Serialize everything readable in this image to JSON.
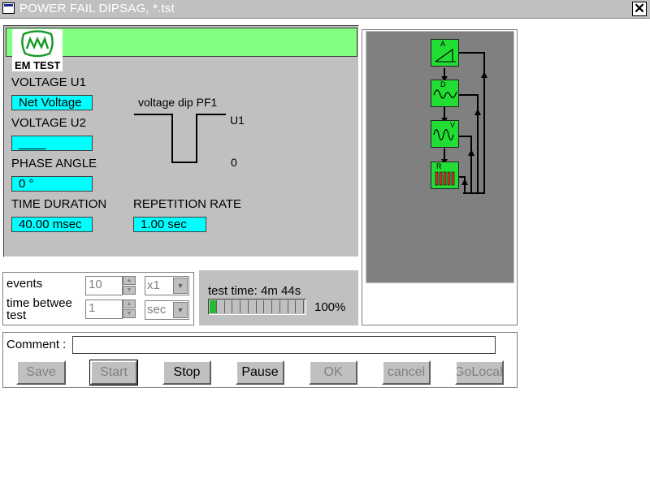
{
  "window": {
    "title": "POWER FAIL DIPSAG, *.tst",
    "close_glyph": "✕"
  },
  "logo": {
    "text": "EM TEST",
    "mark": "em-test-logo"
  },
  "params": {
    "voltage_u1": {
      "label": "VOLTAGE U1",
      "value": "Net Voltage"
    },
    "voltage_u2": {
      "label": "VOLTAGE U2",
      "value": "____"
    },
    "phase_angle": {
      "label": "PHASE ANGLE",
      "value": "0 °"
    },
    "time_duration": {
      "label": "TIME DURATION",
      "value": "40.00 msec"
    },
    "repetition_rate": {
      "label": "REPETITION RATE",
      "value": "1.00 sec"
    }
  },
  "waveform": {
    "title": "voltage dip PF1",
    "upper_label": "U1",
    "lower_label": "0"
  },
  "counters": {
    "events": {
      "label": "events",
      "value": "10",
      "multiplier": "x1"
    },
    "time_between": {
      "label_line1": "time betwee",
      "label_line2": "test",
      "value": "1",
      "unit": "sec"
    }
  },
  "test_status": {
    "label": "test time: 4m 44s",
    "progress_text": "100%",
    "progress": 1.0,
    "segments": 12
  },
  "comment": {
    "label": "Comment :",
    "value": ""
  },
  "buttons": {
    "save": "Save",
    "start": "Start",
    "stop": "Stop",
    "pause": "Pause",
    "ok": "OK",
    "cancel": "cancel",
    "golocal": "GoLocal"
  },
  "diagram": {
    "blocks": [
      {
        "name": "A",
        "icon": "ramp-icon"
      },
      {
        "name": "D",
        "icon": "dip-wave-icon"
      },
      {
        "name": "V",
        "icon": "sine-wave-icon"
      },
      {
        "name": "R",
        "icon": "pulse-train-icon"
      }
    ]
  },
  "colors": {
    "accent_green": "#80ff80",
    "field_cyan": "#00ffff",
    "panel_grey": "#c0c0c0",
    "block_green": "#22dd33",
    "diagram_bg": "#808080"
  }
}
